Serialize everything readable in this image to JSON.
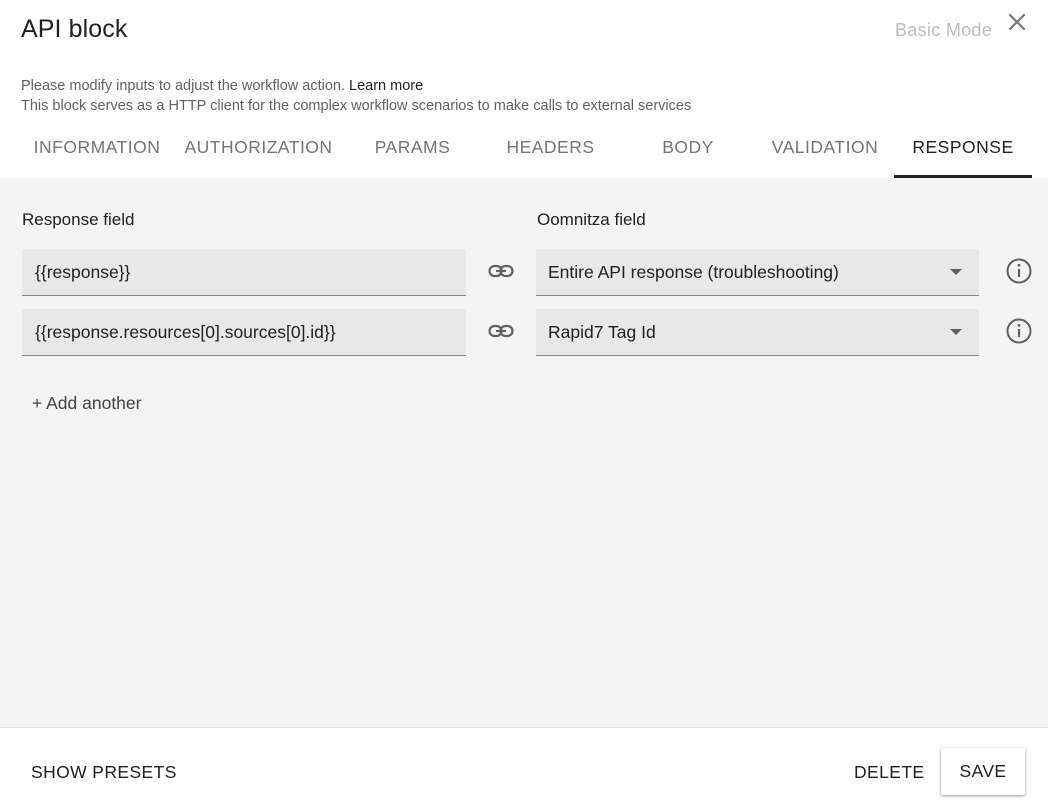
{
  "dialog": {
    "title": "API block",
    "mode_label": "Basic Mode",
    "description_line1": "Please modify inputs to adjust the workflow action.",
    "learn_more": "Learn more",
    "description_line2": "This block serves as a HTTP client for the complex workflow scenarios to make calls to external services"
  },
  "tabs": [
    {
      "label": "INFORMATION",
      "active": false
    },
    {
      "label": "AUTHORIZATION",
      "active": false
    },
    {
      "label": "PARAMS",
      "active": false
    },
    {
      "label": "HEADERS",
      "active": false
    },
    {
      "label": "BODY",
      "active": false
    },
    {
      "label": "VALIDATION",
      "active": false
    },
    {
      "label": "RESPONSE",
      "active": true
    }
  ],
  "response": {
    "response_field_label": "Response field",
    "oomnitza_field_label": "Oomnitza field",
    "rows": [
      {
        "response_value": "{{response}}",
        "oomnitza_value": "Entire API response (troubleshooting)"
      },
      {
        "response_value": "{{response.resources[0].sources[0].id}}",
        "oomnitza_value": "Rapid7 Tag Id"
      }
    ],
    "add_another": "+ Add another"
  },
  "footer": {
    "show_presets": "SHOW PRESETS",
    "delete": "DELETE",
    "save": "SAVE"
  },
  "icons": {
    "close": "close-icon",
    "link": "link-icon",
    "info": "info-icon",
    "dropdown": "chevron-down-icon"
  },
  "colors": {
    "content_background": "#f4f4f4",
    "field_background": "#e8e8e8",
    "active_tab_underline": "#212121",
    "muted_text": "#bdbdbd"
  }
}
